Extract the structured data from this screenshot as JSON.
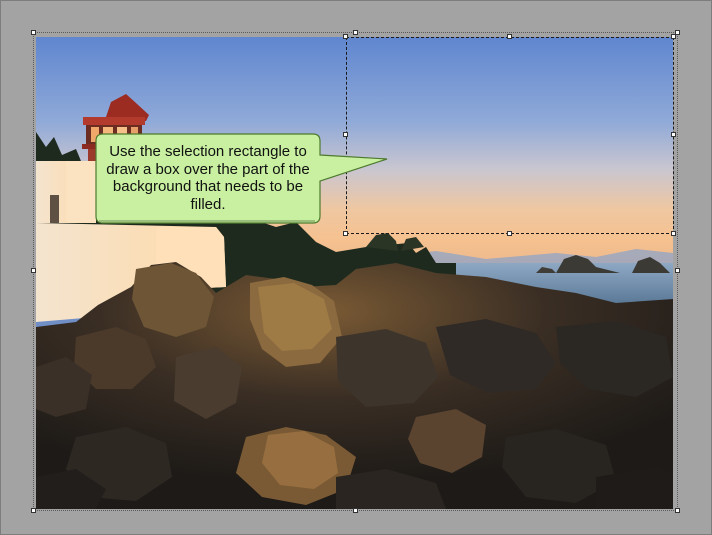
{
  "callout": {
    "text": "Use the selection rectangle to draw a box over the part of the background that needs to be filled."
  },
  "colors": {
    "canvas_background": "#a3a3a3",
    "callout_fill": "#c8f0a0",
    "callout_border": "#4d7a2e",
    "selection_border": "#1b1b1b"
  }
}
